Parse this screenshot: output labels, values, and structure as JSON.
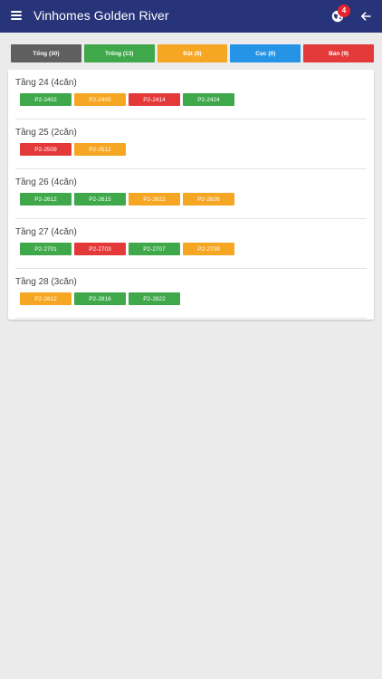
{
  "colors": {
    "appbar": "#283479",
    "all": "#5f5f5f",
    "green": "#3fa84a",
    "orange": "#f5a623",
    "blue": "#2594e6",
    "red": "#e33a39"
  },
  "appbar": {
    "title": "Vinhomes Golden River",
    "notification_count": "4",
    "icons": [
      "menu-icon",
      "globe-icon",
      "back-arrow-icon"
    ]
  },
  "filters": [
    {
      "label": "Tổng (30)",
      "color": "all"
    },
    {
      "label": "Trống (13)",
      "color": "green"
    },
    {
      "label": "Đặt (8)",
      "color": "orange"
    },
    {
      "label": "Cọc (0)",
      "color": "blue"
    },
    {
      "label": "Bán (9)",
      "color": "red"
    }
  ],
  "floors": [
    {
      "title": "Tầng 24 (4căn)",
      "units": [
        {
          "code": "P2-2402",
          "status": "green"
        },
        {
          "code": "P2-2405",
          "status": "orange"
        },
        {
          "code": "P2-2414",
          "status": "red"
        },
        {
          "code": "P2-2424",
          "status": "green"
        }
      ]
    },
    {
      "title": "Tầng 25 (2căn)",
      "units": [
        {
          "code": "P2-2509",
          "status": "red"
        },
        {
          "code": "P2-2512",
          "status": "orange"
        }
      ]
    },
    {
      "title": "Tầng 26 (4căn)",
      "units": [
        {
          "code": "P2-2612",
          "status": "green"
        },
        {
          "code": "P2-2615",
          "status": "green"
        },
        {
          "code": "P2-2622",
          "status": "orange"
        },
        {
          "code": "P2-2626",
          "status": "orange"
        }
      ]
    },
    {
      "title": "Tầng 27 (4căn)",
      "units": [
        {
          "code": "P2-2701",
          "status": "green"
        },
        {
          "code": "P2-2703",
          "status": "red"
        },
        {
          "code": "P2-2707",
          "status": "green"
        },
        {
          "code": "P2-2709",
          "status": "orange"
        }
      ]
    },
    {
      "title": "Tầng 28 (3căn)",
      "units": [
        {
          "code": "P2-2812",
          "status": "orange"
        },
        {
          "code": "P2-2816",
          "status": "green"
        },
        {
          "code": "P2-2822",
          "status": "green"
        }
      ]
    }
  ]
}
